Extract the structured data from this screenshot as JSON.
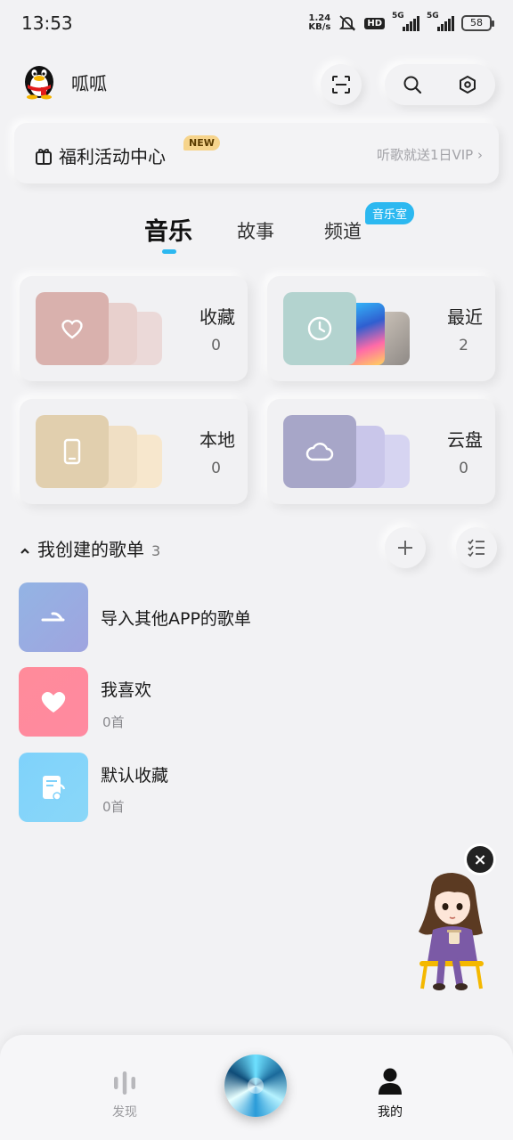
{
  "status_bar": {
    "time": "13:53",
    "net_speed_value": "1.24",
    "net_speed_unit": "KB/s",
    "hd_label": "HD",
    "sim1_label": "5G",
    "sim2_label": "5G",
    "battery": "58"
  },
  "header": {
    "username": "呱呱"
  },
  "welfare": {
    "title": "福利活动中心",
    "badge": "NEW",
    "promo": "听歌就送1日VIP"
  },
  "tabs": [
    {
      "label": "音乐",
      "active": true
    },
    {
      "label": "故事",
      "active": false
    },
    {
      "label": "频道",
      "active": false
    }
  ],
  "room_badge": "音乐室",
  "cards": [
    {
      "label": "收藏",
      "count": "0",
      "color": "#d9b1ad",
      "icon": "heart-outline-icon"
    },
    {
      "label": "最近",
      "count": "2",
      "color": "#b3d3cf",
      "icon": "clock-icon"
    },
    {
      "label": "本地",
      "count": "0",
      "color": "#e1cfae",
      "icon": "phone-icon"
    },
    {
      "label": "云盘",
      "count": "0",
      "color": "#a7a6c8",
      "icon": "cloud-icon"
    }
  ],
  "playlist_section": {
    "title": "我创建的歌单",
    "count": "3"
  },
  "playlists": [
    {
      "title": "导入其他APP的歌单",
      "sub": ""
    },
    {
      "title": "我喜欢",
      "sub": "0首"
    },
    {
      "title": "默认收藏",
      "sub": "0首"
    }
  ],
  "bottom_nav": {
    "discover": "发现",
    "mine": "我的"
  },
  "colors": {
    "accent": "#2cb8f0",
    "background": "#f2f2f4"
  }
}
